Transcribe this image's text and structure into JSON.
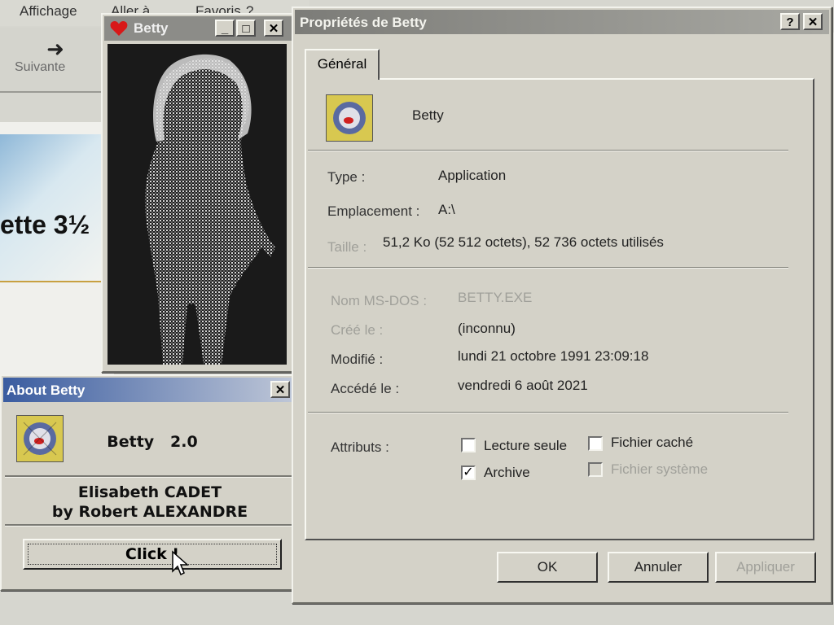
{
  "explorer": {
    "menu": [
      "Affichage",
      "Aller à",
      "Favoris",
      "?"
    ],
    "next_button": "Suivante",
    "banner_text": "ette 3½"
  },
  "betty_window": {
    "title": "Betty"
  },
  "about_window": {
    "title": "About Betty",
    "app_name": "Betty",
    "version": "2.0",
    "author_line1": "Elisabeth CADET",
    "author_line2": "by Robert ALEXANDRE",
    "click_button": "Click !"
  },
  "properties_window": {
    "title": "Propriétés de Betty",
    "tab_general": "Général",
    "app_name": "Betty",
    "type_label": "Type :",
    "type_value": "Application",
    "location_label": "Emplacement :",
    "location_value": "A:\\",
    "size_label": "Taille :",
    "size_value": "51,2 Ko (52 512 octets), 52 736 octets utilisés",
    "msdos_label": "Nom MS-DOS :",
    "msdos_value": "BETTY.EXE",
    "created_label": "Créé le :",
    "created_value": "(inconnu)",
    "modified_label": "Modifié :",
    "modified_value": "lundi 21 octobre 1991 23:09:18",
    "accessed_label": "Accédé le :",
    "accessed_value": "vendredi 6 août 2021",
    "attributes_label": "Attributs :",
    "attr_readonly": "Lecture seule",
    "attr_hidden": "Fichier caché",
    "attr_archive": "Archive",
    "attr_system": "Fichier système",
    "attr_readonly_checked": false,
    "attr_hidden_checked": false,
    "attr_archive_checked": true,
    "attr_system_checked": false,
    "ok_button": "OK",
    "cancel_button": "Annuler",
    "apply_button": "Appliquer"
  },
  "icons": {
    "close": "close-icon",
    "help": "help-icon",
    "minimize": "minimize-icon",
    "maximize": "maximize-icon",
    "heart": "heart-icon",
    "arrow": "arrow-right-icon",
    "cursor": "mouse-cursor-icon"
  },
  "colors": {
    "about_title_start": "#3a5ca0",
    "heart": "#d81818"
  }
}
